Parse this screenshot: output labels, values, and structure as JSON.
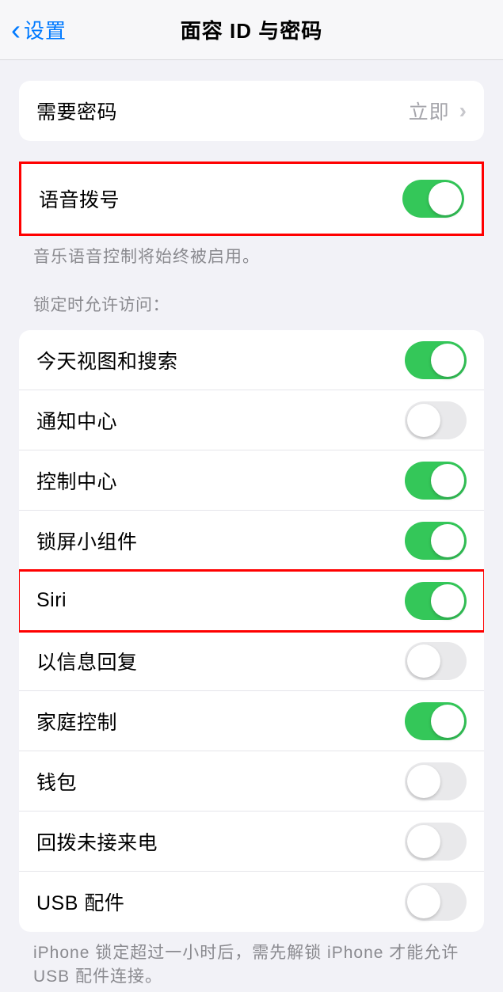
{
  "header": {
    "back_label": "设置",
    "title": "面容 ID 与密码"
  },
  "passcode": {
    "label": "需要密码",
    "value": "立即"
  },
  "voice_dial": {
    "label": "语音拨号",
    "on": true,
    "footer": "音乐语音控制将始终被启用。"
  },
  "lock_access": {
    "header": "锁定时允许访问：",
    "items": [
      {
        "label": "今天视图和搜索",
        "on": true,
        "highlighted": false
      },
      {
        "label": "通知中心",
        "on": false,
        "highlighted": false
      },
      {
        "label": "控制中心",
        "on": true,
        "highlighted": false
      },
      {
        "label": "锁屏小组件",
        "on": true,
        "highlighted": false
      },
      {
        "label": "Siri",
        "on": true,
        "highlighted": true
      },
      {
        "label": "以信息回复",
        "on": false,
        "highlighted": false
      },
      {
        "label": "家庭控制",
        "on": true,
        "highlighted": false
      },
      {
        "label": "钱包",
        "on": false,
        "highlighted": false
      },
      {
        "label": "回拨未接来电",
        "on": false,
        "highlighted": false
      },
      {
        "label": "USB 配件",
        "on": false,
        "highlighted": false
      }
    ],
    "footer": "iPhone 锁定超过一小时后，需先解锁 iPhone 才能允许USB 配件连接。"
  }
}
